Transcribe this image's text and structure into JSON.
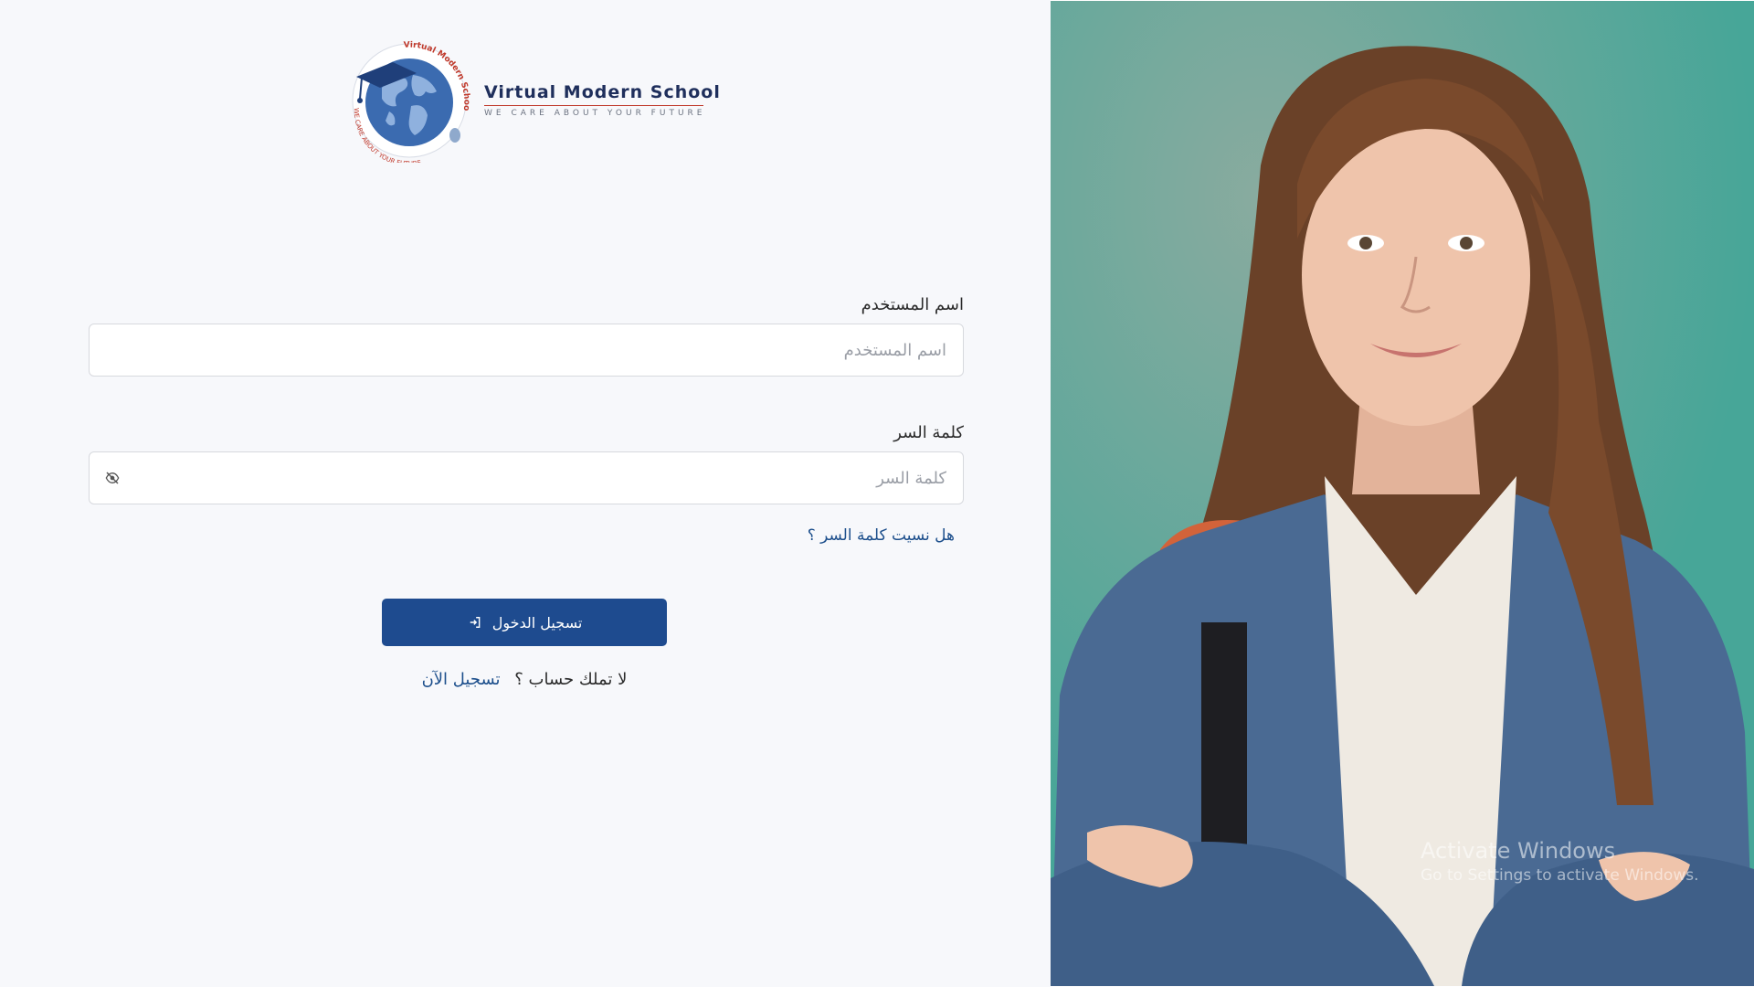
{
  "logo": {
    "title": "Virtual Modern School",
    "tagline": "WE CARE ABOUT YOUR FUTURE",
    "ring_top": "Virtual Modern School",
    "ring_bottom": "WE CARE ABOUT YOUR FUTURE"
  },
  "form": {
    "username": {
      "label": "اسم المستخدم",
      "placeholder": "اسم المستخدم",
      "value": ""
    },
    "password": {
      "label": "كلمة السر",
      "placeholder": "كلمة السر",
      "value": "",
      "toggle_icon": "eye-slash-icon"
    },
    "forgot_password": "هل نسيت كلمة السر ؟",
    "login_button": {
      "label": "تسجيل الدخول",
      "icon": "sign-in-icon"
    },
    "signup": {
      "prompt": "لا تملك حساب ؟",
      "link": "تسجيل الآن"
    }
  },
  "colors": {
    "primary": "#1e4b8f",
    "link": "#1d4f8c",
    "panel_bg": "#f7f8fb",
    "photo_bg": "#5ea99b"
  },
  "watermark": {
    "title": "Activate Windows",
    "subtitle": "Go to Settings to activate Windows."
  }
}
